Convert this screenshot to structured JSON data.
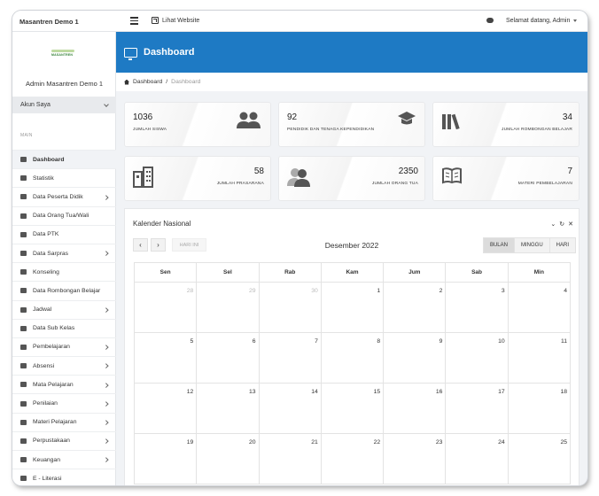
{
  "topbar": {
    "brand": "Masantren Demo 1",
    "site_link": "Lihat Website",
    "greeting": "Selamat datang, Admin"
  },
  "sidebar": {
    "logo_text": "MASANTREN",
    "admin_name": "Admin Masantren Demo 1",
    "account_label": "Akun Saya",
    "section_label": "MAIN",
    "items": [
      {
        "label": "Dashboard",
        "icon": "monitor-icon",
        "has_children": false,
        "active": true
      },
      {
        "label": "Statistik",
        "icon": "bar-chart-icon",
        "has_children": false
      },
      {
        "label": "Data Peserta Didik",
        "icon": "users-icon",
        "has_children": true
      },
      {
        "label": "Data Orang Tua/Wali",
        "icon": "user-icon",
        "has_children": false
      },
      {
        "label": "Data PTK",
        "icon": "teacher-icon",
        "has_children": false
      },
      {
        "label": "Data Sarpras",
        "icon": "building-icon",
        "has_children": true
      },
      {
        "label": "Konseling",
        "icon": "chat-icon",
        "has_children": false
      },
      {
        "label": "Data Rombongan Belajar",
        "icon": "books-icon",
        "has_children": false
      },
      {
        "label": "Jadwal",
        "icon": "calendar-icon",
        "has_children": true
      },
      {
        "label": "Data Sub Kelas",
        "icon": "books-icon",
        "has_children": false
      },
      {
        "label": "Pembelajaran",
        "icon": "folder-icon",
        "has_children": true
      },
      {
        "label": "Absensi",
        "icon": "calendar-check-icon",
        "has_children": true
      },
      {
        "label": "Mata Pelajaran",
        "icon": "book-icon",
        "has_children": true
      },
      {
        "label": "Penilaian",
        "icon": "clipboard-icon",
        "has_children": true
      },
      {
        "label": "Materi Pelajaran",
        "icon": "book-open-icon",
        "has_children": true
      },
      {
        "label": "Perpustakaan",
        "icon": "library-icon",
        "has_children": true
      },
      {
        "label": "Keuangan",
        "icon": "money-icon",
        "has_children": true
      },
      {
        "label": "E - Literasi",
        "icon": "reader-icon",
        "has_children": false
      }
    ]
  },
  "header": {
    "title": "Dashboard"
  },
  "breadcrumb": {
    "home": "Dashboard",
    "separator": "/",
    "current": "Dashboard"
  },
  "stats": [
    {
      "value": "1036",
      "label": "JUMLAH SISWA",
      "icon": "users-icon"
    },
    {
      "value": "92",
      "label": "PENDIDIK DAN TENAGA KEPENDIDIKAN",
      "icon": "graduation-cap-icon"
    },
    {
      "value": "34",
      "label": "JUMLAH ROMBONGAN BELAJAR",
      "icon": "books-icon"
    },
    {
      "value": "58",
      "label": "JUMLAH PRASARANA",
      "icon": "building-icon"
    },
    {
      "value": "2350",
      "label": "JUMLAH ORANG TUA",
      "icon": "parents-icon"
    },
    {
      "value": "7",
      "label": "MATERI PEMBELAJARAN",
      "icon": "book-open-icon"
    }
  ],
  "calendar": {
    "title": "Kalender Nasional",
    "prev": "‹",
    "next": "›",
    "today_label": "HARI INI",
    "month_label": "Desember 2022",
    "views": [
      "BULAN",
      "MINGGU",
      "HARI"
    ],
    "active_view": "BULAN",
    "weekdays": [
      "Sen",
      "Sel",
      "Rab",
      "Kam",
      "Jum",
      "Sab",
      "Min"
    ],
    "weeks": [
      [
        {
          "d": "28",
          "other": true
        },
        {
          "d": "29",
          "other": true
        },
        {
          "d": "30",
          "other": true
        },
        {
          "d": "1"
        },
        {
          "d": "2"
        },
        {
          "d": "3"
        },
        {
          "d": "4"
        }
      ],
      [
        {
          "d": "5"
        },
        {
          "d": "6"
        },
        {
          "d": "7"
        },
        {
          "d": "8"
        },
        {
          "d": "9"
        },
        {
          "d": "10"
        },
        {
          "d": "11"
        }
      ],
      [
        {
          "d": "12"
        },
        {
          "d": "13"
        },
        {
          "d": "14"
        },
        {
          "d": "15"
        },
        {
          "d": "16"
        },
        {
          "d": "17"
        },
        {
          "d": "18"
        }
      ],
      [
        {
          "d": "19"
        },
        {
          "d": "20"
        },
        {
          "d": "21"
        },
        {
          "d": "22"
        },
        {
          "d": "23"
        },
        {
          "d": "24"
        },
        {
          "d": "25"
        }
      ]
    ]
  },
  "colors": {
    "primary": "#1e7ac4",
    "sidebar_active": "#f1f3f6"
  }
}
